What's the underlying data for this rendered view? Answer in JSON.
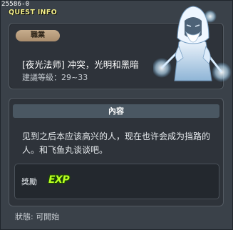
{
  "window": {
    "quest_id": "25586-0",
    "title": "QUEST INFO"
  },
  "job": {
    "tag": "職業",
    "quest_name": "[夜光法师] 冲突，光明和黑暗",
    "level_label": "建議等級：29~33"
  },
  "npc": {
    "icon": "mage-npc-portrait"
  },
  "content": {
    "header": "內容",
    "text_line1": "见到之后本应该高兴的人，现在也许会成为挡路的",
    "text_line2": "人。和飞鱼丸谈谈吧。"
  },
  "reward": {
    "label": "獎勵",
    "exp": "EXP"
  },
  "status": {
    "text": "狀態:  可開始"
  }
}
